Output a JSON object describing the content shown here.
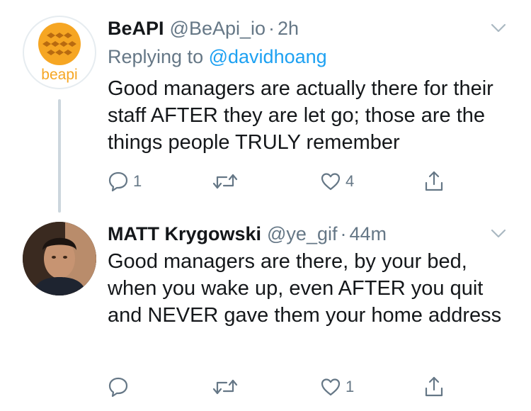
{
  "tweets": [
    {
      "name": "BeAPI",
      "handle": "@BeApi_io",
      "separator": "·",
      "time": "2h",
      "replying_prefix": "Replying to",
      "replying_to": "@davidhoang",
      "text": "Good managers are actually there for their staff AFTER they are let go; those are the things people TRULY remember",
      "avatar_logo_text": "beapi",
      "counts": {
        "replies": "1",
        "retweets": "",
        "likes": "4"
      }
    },
    {
      "name": "MATT Krygowski",
      "handle": "@ye_gif",
      "separator": "·",
      "time": "44m",
      "text": "Good managers are there, by your bed, when you wake up, even AFTER you quit and NEVER gave them your home address",
      "counts": {
        "replies": "",
        "retweets": "",
        "likes": "1"
      }
    }
  ],
  "colors": {
    "text": "#14171a",
    "secondary": "#657786",
    "link": "#1da1f2",
    "thread_line": "#ccd6dd",
    "logo_orange": "#f6a623"
  },
  "icons": {
    "reply": "speech-bubble-icon",
    "retweet": "retweet-arrows-icon",
    "like": "heart-icon",
    "share": "share-upload-icon",
    "menu": "chevron-down-icon"
  }
}
